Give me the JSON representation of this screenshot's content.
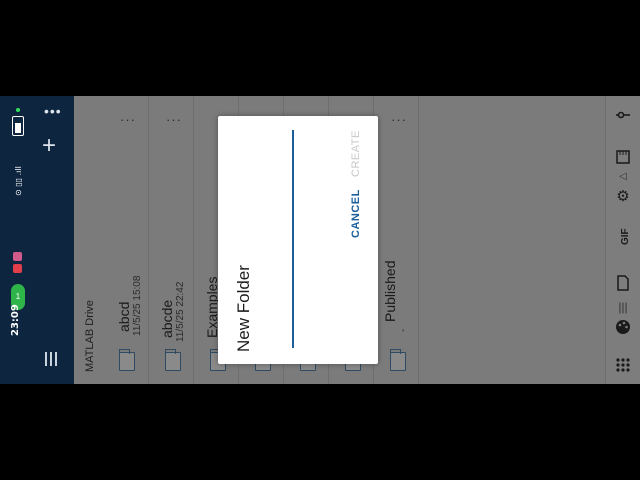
{
  "status": {
    "time": "23:09",
    "call_pill": "1",
    "signal_text": "⊙ ▯▯ .ıll"
  },
  "nav": {
    "more": "•••",
    "add": "+"
  },
  "files": {
    "root_label": "MATLAB Drive",
    "items": [
      {
        "name": "abcd",
        "date": "11/5/25 15:08",
        "more": "···"
      },
      {
        "name": "abcde",
        "date": "11/5/25 22:42",
        "more": "···"
      },
      {
        "name": "Examples",
        "date": "",
        "more": ""
      },
      {
        "name": "Published",
        "date": "-",
        "more": "···"
      }
    ]
  },
  "dialog": {
    "title": "New Folder",
    "input_value": "",
    "cancel_label": "CANCEL",
    "create_label": "CREATE"
  },
  "tools": {
    "gif_label": "GIF"
  },
  "colors": {
    "nav_bg": "#0e253f",
    "accent": "#1b5e9a",
    "overlay": "#7b7b7b"
  },
  "icons": [
    "battery-icon",
    "signal-icon",
    "more-icon",
    "add-icon",
    "menu-icon",
    "folder-icon",
    "touch-icon",
    "sd-card-icon",
    "settings-icon",
    "gif-icon",
    "file-icon",
    "palette-icon",
    "grid-icon"
  ]
}
